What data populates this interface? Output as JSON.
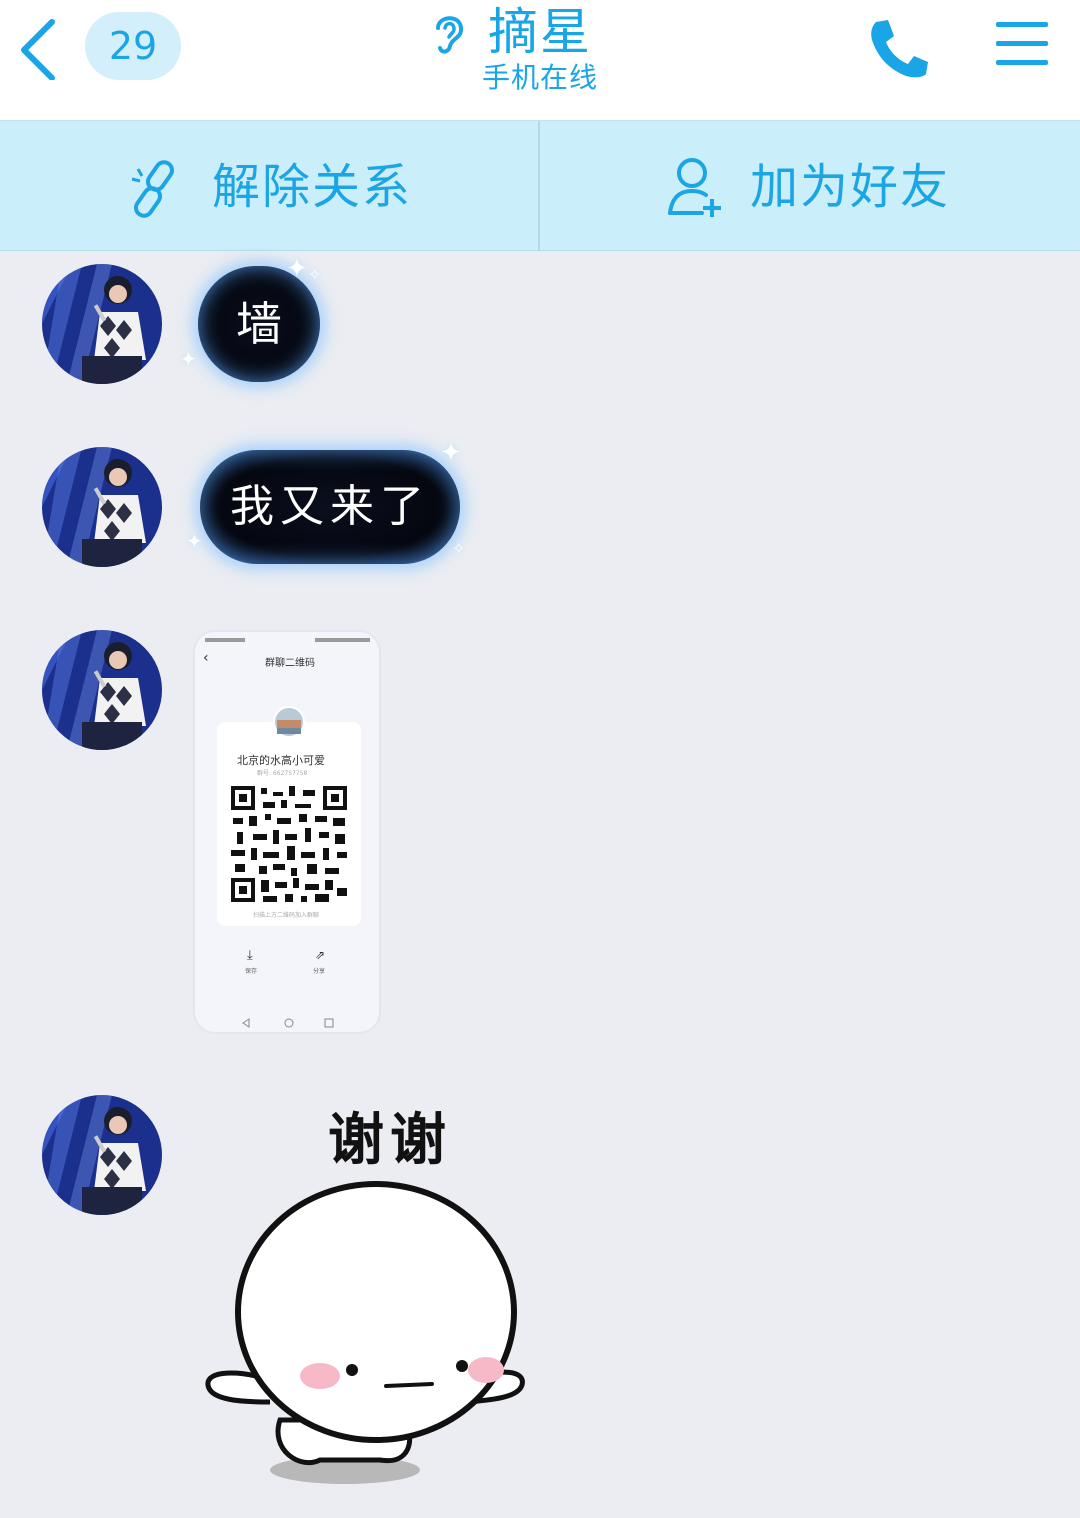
{
  "header": {
    "unread_count": "29",
    "contact_name": "摘星",
    "status": "手机在线"
  },
  "actions": {
    "remove_relation": "解除关系",
    "add_friend": "加为好友"
  },
  "messages": [
    {
      "type": "text",
      "text": "墙"
    },
    {
      "type": "text",
      "text": "我又来了"
    },
    {
      "type": "image",
      "screen_title": "群聊二维码",
      "name": "北京的水高小可爱",
      "sub_text": "群号: 662757758",
      "hint": "扫描上方二维码加入群聊",
      "save_label": "保存",
      "share_label": "分享"
    },
    {
      "type": "sticker",
      "caption": "谢谢"
    }
  ],
  "colors": {
    "accent": "#19a5e6",
    "action_bar_bg": "#cbeefb",
    "chat_bg": "#ebedf2"
  },
  "icons": [
    "back-icon",
    "ear-icon",
    "phone-icon",
    "menu-icon",
    "unlink-icon",
    "add-friend-icon"
  ]
}
